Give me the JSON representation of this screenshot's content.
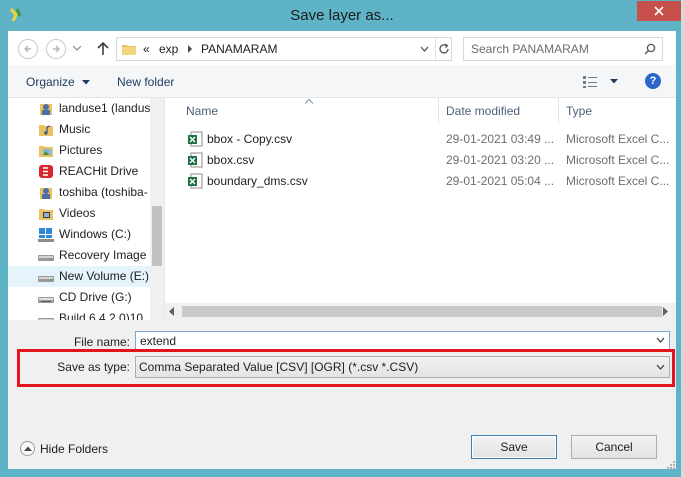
{
  "window": {
    "title": "Save layer as...",
    "close_label": "Close",
    "accent_color": "#5fb3c7",
    "close_color": "#c7504a"
  },
  "address_bar": {
    "overflow": "«",
    "crumbs": [
      "exp",
      "PANAMARAM"
    ]
  },
  "search": {
    "placeholder": "Search PANAMARAM"
  },
  "toolbar": {
    "organize": "Organize",
    "new_folder": "New folder",
    "help": "?"
  },
  "nav_pane": {
    "items": [
      {
        "label": "landuse1 (landus",
        "icon": "user-folder-icon"
      },
      {
        "label": "Music",
        "icon": "music-folder-icon"
      },
      {
        "label": "Pictures",
        "icon": "pictures-folder-icon"
      },
      {
        "label": "REACHit Drive",
        "icon": "reachit-drive-icon"
      },
      {
        "label": "toshiba (toshiba-",
        "icon": "user-folder-icon"
      },
      {
        "label": "Videos",
        "icon": "videos-folder-icon"
      },
      {
        "label": "Windows (C:)",
        "icon": "windows-drive-icon"
      },
      {
        "label": "Recovery Image (",
        "icon": "hard-drive-icon"
      },
      {
        "label": "New Volume (E:)",
        "icon": "hard-drive-icon",
        "selected": true
      },
      {
        "label": "CD Drive (G:)",
        "icon": "cd-drive-icon"
      },
      {
        "label": "Build 6.4.2.0)10",
        "icon": "hard-drive-icon"
      }
    ]
  },
  "file_list": {
    "columns": [
      "Name",
      "Date modified",
      "Type"
    ],
    "rows": [
      {
        "name": "bbox - Copy.csv",
        "date": "29-01-2021 03:49 ...",
        "type": "Microsoft Excel C...",
        "icon": "csv-file-icon"
      },
      {
        "name": "bbox.csv",
        "date": "29-01-2021 03:20 ...",
        "type": "Microsoft Excel C...",
        "icon": "csv-file-icon"
      },
      {
        "name": "boundary_dms.csv",
        "date": "29-01-2021 05:04 ...",
        "type": "Microsoft Excel C...",
        "icon": "csv-file-icon"
      }
    ]
  },
  "form": {
    "file_name_label": "File name:",
    "file_name_value": "extend",
    "save_type_label": "Save as type:",
    "save_type_value": "Comma Separated Value [CSV] [OGR] (*.csv *.CSV)",
    "highlight_color": "#e2141c"
  },
  "footer": {
    "hide_folders": "Hide Folders",
    "save": "Save",
    "cancel": "Cancel"
  }
}
